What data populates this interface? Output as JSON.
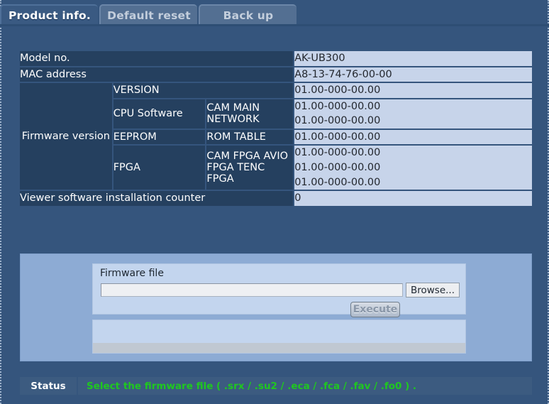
{
  "tabs": [
    {
      "label": "Product info.",
      "active": true
    },
    {
      "label": "Default reset",
      "active": false
    },
    {
      "label": "Back up",
      "active": false
    }
  ],
  "info_table": {
    "model_label": "Model no.",
    "model_value": "AK-UB300",
    "mac_label": "MAC address",
    "mac_value": "A8-13-74-76-00-00",
    "firmware_label": "Firmware version",
    "firmware_rows": [
      {
        "group": "VERSION",
        "sub": [],
        "values": [
          "01.00-000-00.00"
        ]
      },
      {
        "group": "CPU Software",
        "sub": [
          "CAM MAIN",
          "NETWORK"
        ],
        "values": [
          "01.00-000-00.00",
          "01.00-000-00.00"
        ]
      },
      {
        "group": "EEPROM",
        "sub": [
          "ROM TABLE"
        ],
        "values": [
          "01.00-000-00.00"
        ]
      },
      {
        "group": "FPGA",
        "sub": [
          "CAM FPGA",
          "AVIO FPGA",
          "TENC FPGA"
        ],
        "values": [
          "01.00-000-00.00",
          "01.00-000-00.00",
          "01.00-000-00.00"
        ]
      }
    ],
    "counter_label": "Viewer software installation counter",
    "counter_value": "0"
  },
  "firmware_panel": {
    "file_label": "Firmware file",
    "file_value": "",
    "file_placeholder": "",
    "browse_label": "Browse...",
    "execute_label": "Execute"
  },
  "status": {
    "label": "Status",
    "message": "Select the firmware file ( .srx / .su2 / .eca / .fca / .fav / .fo0 ) ."
  },
  "colors": {
    "page_background": "#35557d",
    "header_cell": "#25405f",
    "value_cell": "#c7d4ea",
    "panel_outer": "#8dabd4",
    "panel_inner": "#c3d5ee",
    "status_green": "#1fc81f",
    "tab_active": "#3a5a82",
    "tab_inactive": "#536f92"
  }
}
